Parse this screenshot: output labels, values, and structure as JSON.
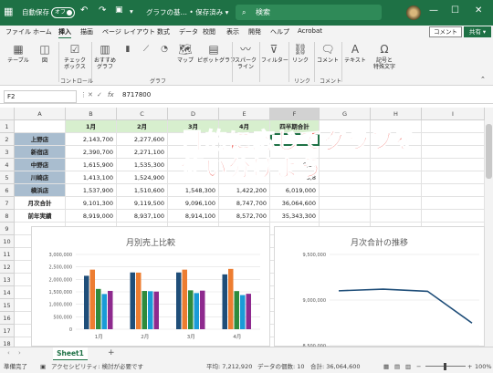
{
  "titlebar": {
    "autosave_label": "自動保存",
    "autosave_state": "オフ",
    "filename": "グラフの基… • 保存済み ▾",
    "search_placeholder": "検索",
    "min": "—",
    "max": "☐",
    "close": "✕"
  },
  "menus": [
    "ファイル",
    "ホーム",
    "挿入",
    "描画",
    "ページ レイアウト",
    "数式",
    "データ",
    "校閲",
    "表示",
    "開発",
    "ヘルプ",
    "Acrobat"
  ],
  "active_menu": "挿入",
  "comment_label": "コメント",
  "share_label": "共有 ▾",
  "ribbon": {
    "items": [
      "テーブル",
      "図",
      "チェック\nボックス",
      "おすすめ\nグラフ",
      "マップ",
      "ピボットグラフ",
      "スパーク\nライン",
      "フィルター",
      "リンク",
      "コメント",
      "テキスト",
      "記号と\n特殊文字"
    ],
    "groups": [
      "コントロール",
      "グラフ",
      "リンク",
      "コメント"
    ]
  },
  "formula": {
    "cell_ref": "F2",
    "fx": "fx",
    "value": "8717800"
  },
  "grid": {
    "col_headers": [
      "A",
      "B",
      "C",
      "D",
      "E",
      "F",
      "G",
      "H",
      "I"
    ],
    "row_headers": [
      "1",
      "2",
      "3",
      "4",
      "5",
      "6",
      "7",
      "8",
      "9",
      "10",
      "11",
      "12",
      "13",
      "14",
      "15",
      "16",
      "17",
      "18"
    ],
    "header_row": [
      "",
      "1月",
      "2月",
      "3月",
      "4月",
      "四半期合計"
    ],
    "rows": [
      [
        "上野店",
        "2,143,700",
        "2,277,600",
        "",
        "",
        ""
      ],
      [
        "新宿店",
        "2,390,700",
        "2,271,100",
        "",
        "",
        ""
      ],
      [
        "中野店",
        "1,615,900",
        "1,535,300",
        "",
        "",
        "6,34"
      ],
      [
        "川崎店",
        "1,413,100",
        "1,524,900",
        "",
        "",
        "5,8"
      ],
      [
        "横浜店",
        "1,537,900",
        "1,510,600",
        "1,548,300",
        "1,422,200",
        "6,019,000"
      ],
      [
        "月次合計",
        "9,101,300",
        "9,119,500",
        "9,096,100",
        "8,747,700",
        "36,064,600"
      ],
      [
        "前年実績",
        "8,919,000",
        "8,937,100",
        "8,914,100",
        "8,572,700",
        "35,343,300"
      ]
    ]
  },
  "overlay_text": [
    "目的に応じてグラフを",
    "使い分けよう"
  ],
  "chart_data": [
    {
      "type": "bar",
      "title": "月別売上比較",
      "categories": [
        "1月",
        "2月",
        "3月",
        "4月"
      ],
      "ylim": [
        0,
        3000000
      ],
      "yticks": [
        "0",
        "500,000",
        "1,000,000",
        "1,500,000",
        "2,000,000",
        "2,500,000",
        "3,000,000"
      ],
      "series": [
        {
          "values": [
            2143700,
            2277600,
            2277600,
            2200000
          ],
          "color": "#1f4e79"
        },
        {
          "values": [
            2390700,
            2271100,
            2390700,
            2420000
          ],
          "color": "#ed7d31"
        },
        {
          "values": [
            1615900,
            1535300,
            1560000,
            1530000
          ],
          "color": "#2e8b3d"
        },
        {
          "values": [
            1413100,
            1524900,
            1450000,
            1370000
          ],
          "color": "#1a9bd7"
        },
        {
          "values": [
            1537900,
            1510600,
            1548300,
            1422200
          ],
          "color": "#8e2a8e"
        }
      ],
      "grid": true
    },
    {
      "type": "line",
      "title": "月次合計の推移",
      "categories": [
        "1月",
        "2月",
        "3月",
        "4月"
      ],
      "values": [
        9101300,
        9119500,
        9096100,
        8747700
      ],
      "ylim": [
        8500000,
        9500000
      ],
      "yticks": [
        "8,500,000",
        "9,000,000",
        "9,500,000"
      ],
      "color": "#1f4e79",
      "grid": true
    }
  ],
  "sheet_tab": "Sheet1",
  "add_sheet": "+",
  "status": {
    "ready": "準備完了",
    "accessibility": "アクセシビリティ: 検討が必要です",
    "average": "平均: 7,212,920",
    "count": "データの個数: 10",
    "sum": "合計: 36,064,600",
    "zoom": "100%"
  },
  "colors": {
    "excel_green": "#1e7145",
    "store_fill": "#a9bdcf",
    "month_fill": "#d7efce",
    "overlay_red": "#e8372f"
  }
}
